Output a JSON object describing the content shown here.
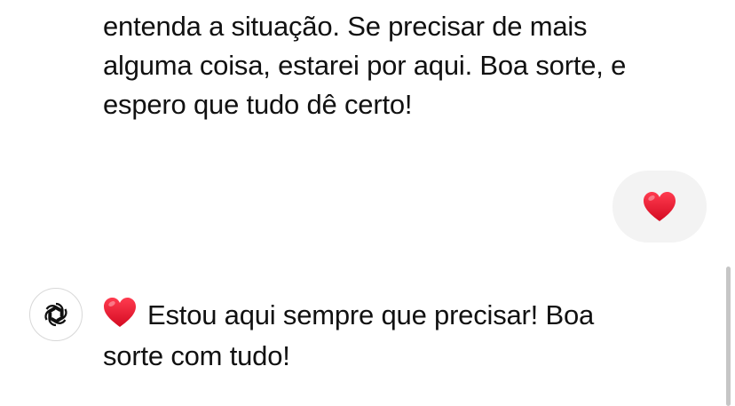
{
  "previous_message": {
    "lines": [
      "entenda a situação. Se precisar de mais",
      "alguma coisa, estarei por aqui. Boa sorte, e",
      "espero que tudo dê certo!"
    ]
  },
  "user_message": {
    "emoji": "heart-emoji"
  },
  "assistant_message": {
    "avatar_icon": "openai-logo-icon",
    "emoji": "heart-emoji",
    "lines": [
      "Estou aqui sempre que precisar! Boa",
      "sorte com tudo!"
    ]
  },
  "colors": {
    "heart": "#e8112d",
    "user_bubble": "#f3f3f3",
    "text": "#111111"
  }
}
